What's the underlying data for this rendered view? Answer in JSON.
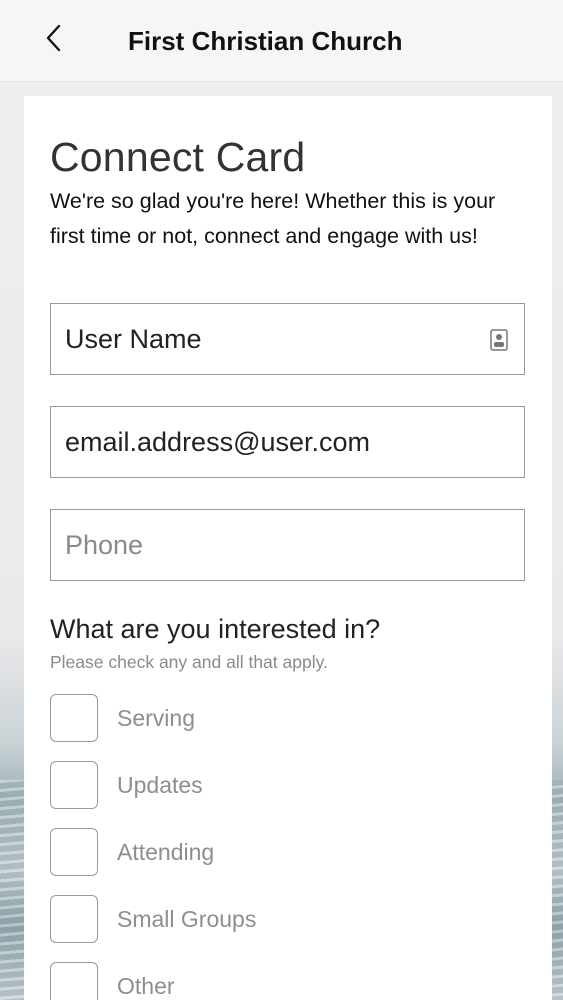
{
  "header": {
    "back_icon": "chevron-left-icon",
    "title": "First Christian Church"
  },
  "card": {
    "title": "Connect Card",
    "intro": "We're so glad you're here! Whether this is your first time or not, connect and engage with us!",
    "fields": {
      "user_name": {
        "value": "User Name",
        "placeholder": "",
        "icon": "contact-card-icon"
      },
      "email": {
        "value": "email.address@user.com",
        "placeholder": ""
      },
      "phone": {
        "value": "",
        "placeholder": "Phone"
      }
    },
    "interests": {
      "question": "What are you interested in?",
      "hint": "Please check any and all that apply.",
      "options": [
        {
          "label": "Serving",
          "checked": false
        },
        {
          "label": "Updates",
          "checked": false
        },
        {
          "label": "Attending",
          "checked": false
        },
        {
          "label": "Small Groups",
          "checked": false
        },
        {
          "label": "Other",
          "checked": false
        }
      ]
    }
  },
  "colors": {
    "header_bg": "#f7f6f7",
    "card_bg": "#ffffff",
    "border": "#9a9a9a",
    "muted_text": "#8e8e8e"
  }
}
